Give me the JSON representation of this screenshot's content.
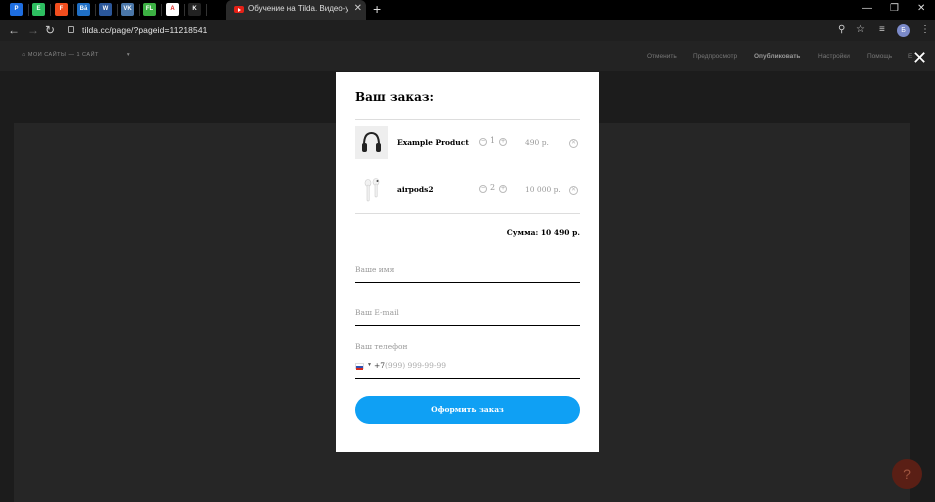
{
  "browser": {
    "tab_title": "Обучение на Tilda. Видео-урок",
    "tab_close": "✕",
    "new_tab": "+",
    "url": "tilda.cc/page/?pageid=11218541",
    "profile_initial": "Б",
    "pinned_tabs": [
      {
        "icon": "tilda-icon",
        "color": "#1e6ee0",
        "glyph": "P"
      },
      {
        "icon": "evernote-icon",
        "color": "#2dbe60",
        "glyph": "E"
      },
      {
        "icon": "figma-icon",
        "color": "#f24e1e",
        "glyph": "F"
      },
      {
        "icon": "ba-icon",
        "color": "#1f6fc5",
        "glyph": "Bā"
      },
      {
        "icon": "word-icon",
        "color": "#2b579a",
        "glyph": "W"
      },
      {
        "icon": "vk-icon",
        "color": "#4a76a8",
        "glyph": "VK"
      },
      {
        "icon": "freelance-icon",
        "color": "#3cb043",
        "glyph": "FL"
      },
      {
        "icon": "acrobat-icon",
        "color": "#ffffff",
        "glyph": "A"
      },
      {
        "icon": "kite-icon",
        "color": "#222222",
        "glyph": "K"
      }
    ],
    "window_controls": {
      "minimize": "—",
      "restore": "❐",
      "close": "✕"
    }
  },
  "editor": {
    "breadcrumb_home": "МОИ САЙТЫ",
    "breadcrumb_sep": "—",
    "breadcrumb_site": "1 САЙТ",
    "caret": "▾",
    "menu": [
      {
        "label": "Отменить",
        "bold": false
      },
      {
        "label": "Предпросмотр",
        "bold": false
      },
      {
        "label": "Опубликовать",
        "bold": true
      },
      {
        "label": "Настройки",
        "bold": false
      },
      {
        "label": "Помощь",
        "bold": false
      },
      {
        "label": "Е",
        "bold": false
      }
    ],
    "help_label": "?"
  },
  "modal": {
    "close": "✕",
    "title": "Ваш заказ:",
    "items": [
      {
        "name": "Example Product",
        "qty": "1",
        "price": "490 р.",
        "thumb": "headphones-icon"
      },
      {
        "name": "airpods2",
        "qty": "2",
        "price": "10 000 р.",
        "thumb": "airpods-icon"
      }
    ],
    "qty_minus": "−",
    "qty_plus": "+",
    "delete": "✕",
    "total": "Сумма: 10 490 р.",
    "name_placeholder": "Ваше имя",
    "email_placeholder": "Ваш E-mail",
    "phone_label": "Ваш телефон",
    "phone_code": "+7",
    "phone_placeholder": "(999) 999-99-99",
    "submit": "Оформить заказ"
  },
  "colors": {
    "accent": "#0fa0f4",
    "overlay": "#1c1c1c",
    "help_button": "#5a1f15"
  }
}
